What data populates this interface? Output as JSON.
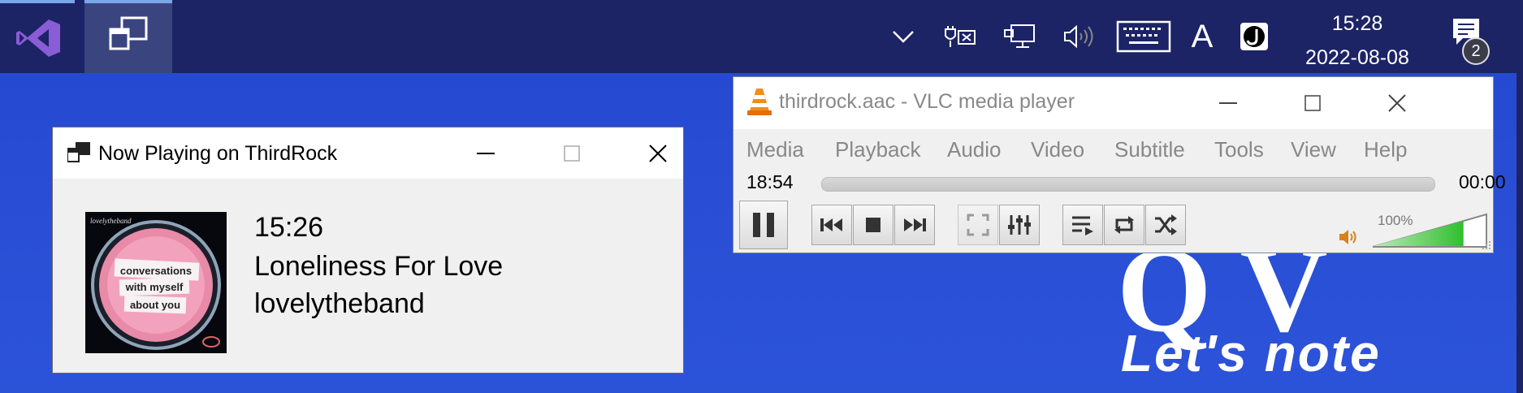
{
  "taskbar": {
    "apps": [
      {
        "name": "Visual Studio",
        "icon": "visual-studio-icon"
      },
      {
        "name": "Task View",
        "icon": "task-view-icon"
      }
    ],
    "tray": {
      "chevron_icon": "chevron-down-icon",
      "power_icon": "power-plug-icon",
      "network_icon": "network-icon",
      "volume_icon": "speaker-icon",
      "keyboard_icon": "touch-keyboard-icon",
      "ime_mode": "A",
      "ime_app_icon": "japanese-ime-icon",
      "time": "15:28",
      "date": "2022-08-08",
      "notification_count": "2"
    }
  },
  "now_playing": {
    "title": "Now Playing on ThirdRock",
    "time": "15:26",
    "song": "Loneliness For Love",
    "artist": "lovelytheband",
    "album_art": {
      "label_top": "lovelytheband",
      "line1": "conversations",
      "line2": "with myself",
      "line3": "about you"
    }
  },
  "vlc": {
    "title": "thirdrock.aac - VLC media player",
    "menu": [
      "Media",
      "Playback",
      "Audio",
      "Video",
      "Subtitle",
      "Tools",
      "View",
      "Help"
    ],
    "elapsed": "18:54",
    "remaining": "00:00",
    "volume_label": "100%",
    "volume_level": 1.0,
    "progress": 0
  },
  "wallpaper": {
    "mark": "Q V",
    "brand": "Let's note"
  },
  "colors": {
    "taskbar": "#1c2466",
    "desktop": "#2a4fd6",
    "volume_green": "#3cc43c"
  }
}
